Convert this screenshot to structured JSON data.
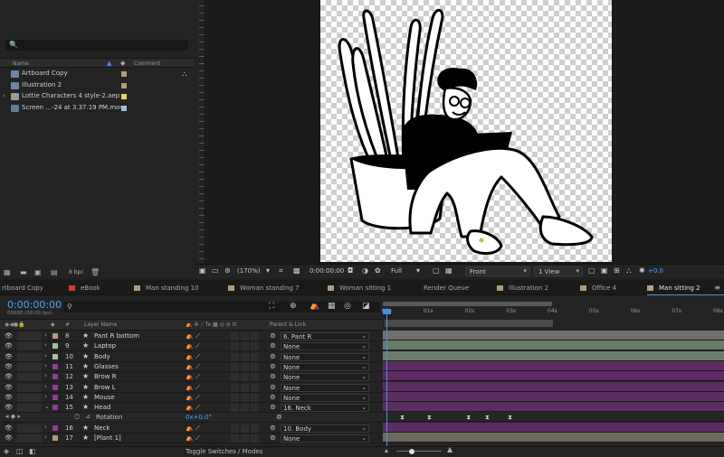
{
  "project": {
    "search_icon": "🔍",
    "columns": {
      "name": "Name",
      "comment": "Comment"
    },
    "items": [
      {
        "name": "Artboard Copy",
        "icon": "composition-icon",
        "label_color": "#b39c7a",
        "expandable": false
      },
      {
        "name": "Illustration 2",
        "icon": "composition-icon",
        "label_color": "#b39c7a",
        "expandable": false
      },
      {
        "name": "Lottie Characters 4 style-2.aep",
        "icon": "folder-icon",
        "label_color": "#e7d35a",
        "expandable": true
      },
      {
        "name": "Screen ...-24 at 3.37.19 PM.mov",
        "icon": "footage-icon",
        "label_color": "#9cc1d4",
        "expandable": false
      }
    ],
    "bit_depth": "8 bpc"
  },
  "viewer": {
    "zoom": "(170%)",
    "timecode": "0:00:00:00",
    "resolution": "Full",
    "view": "Front",
    "views_count": "1 View",
    "exposure": "+0.0"
  },
  "tabs": [
    {
      "label": "rtboard Copy",
      "color": "",
      "active": false
    },
    {
      "label": "eBook",
      "color": "#c8383a",
      "active": false
    },
    {
      "label": "Man standing 10",
      "color": "#b39c7a",
      "active": false
    },
    {
      "label": "Woman standing 7",
      "color": "#b39c7a",
      "active": false
    },
    {
      "label": "Woman sitting 1",
      "color": "#b39c7a",
      "active": false
    },
    {
      "label": "Render Queue",
      "color": "",
      "active": false
    },
    {
      "label": "Illustration 2",
      "color": "#b39c7a",
      "active": false
    },
    {
      "label": "Office 4",
      "color": "#b39c7a",
      "active": false
    },
    {
      "label": "Man sitting 2",
      "color": "#b39c7a",
      "active": true
    }
  ],
  "timeline": {
    "timecode": "0:00:00:00",
    "timecode_sub": "00000 (30.00 fps)",
    "header": {
      "layer_name": "Layer Name",
      "parent_link": "Parent & Link"
    },
    "ruler_labels": [
      "00s",
      "01s",
      "02s",
      "03s",
      "04s",
      "05s",
      "06s",
      "07s",
      "08s"
    ],
    "layers": [
      {
        "num": "8",
        "name": "Pant R bottom",
        "parent": "6. Pant R",
        "label_color": "#b39c7a",
        "expanded": false,
        "track_color": "#6f6f6f"
      },
      {
        "num": "9",
        "name": "Laptop",
        "parent": "None",
        "label_color": "#a6c1a0",
        "expanded": false,
        "track_color": "#6b7c6b"
      },
      {
        "num": "10",
        "name": "Body",
        "parent": "None",
        "label_color": "#a6c1a0",
        "expanded": false,
        "track_color": "#6b7c6b"
      },
      {
        "num": "11",
        "name": "Glasses",
        "parent": "None",
        "label_color": "#8f3c97",
        "expanded": false,
        "track_color": "#5b2d63"
      },
      {
        "num": "12",
        "name": "Brow R",
        "parent": "None",
        "label_color": "#8f3c97",
        "expanded": false,
        "track_color": "#5b2d63"
      },
      {
        "num": "13",
        "name": "Brow L",
        "parent": "None",
        "label_color": "#8f3c97",
        "expanded": false,
        "track_color": "#5b2d63"
      },
      {
        "num": "14",
        "name": "Mouse",
        "parent": "None",
        "label_color": "#8f3c97",
        "expanded": false,
        "track_color": "#5b2d63"
      },
      {
        "num": "15",
        "name": "Head",
        "parent": "16. Neck",
        "label_color": "#8f3c97",
        "expanded": true,
        "track_color": "#5b2d63"
      },
      {
        "num": "16",
        "name": "Neck",
        "parent": "10. Body",
        "label_color": "#8f3c97",
        "expanded": false,
        "track_color": "#5b2d63"
      },
      {
        "num": "17",
        "name": "[Plant 1]",
        "parent": "None",
        "label_color": "#b39c7a",
        "expanded": false,
        "track_color": "#6f6a5e"
      }
    ],
    "property": {
      "name": "Rotation",
      "value": "0x+0.0°",
      "keyframes_seconds": [
        0.2,
        0.85,
        1.8,
        2.25,
        2.8
      ]
    },
    "toggle_label": "Toggle Switches / Modes"
  }
}
